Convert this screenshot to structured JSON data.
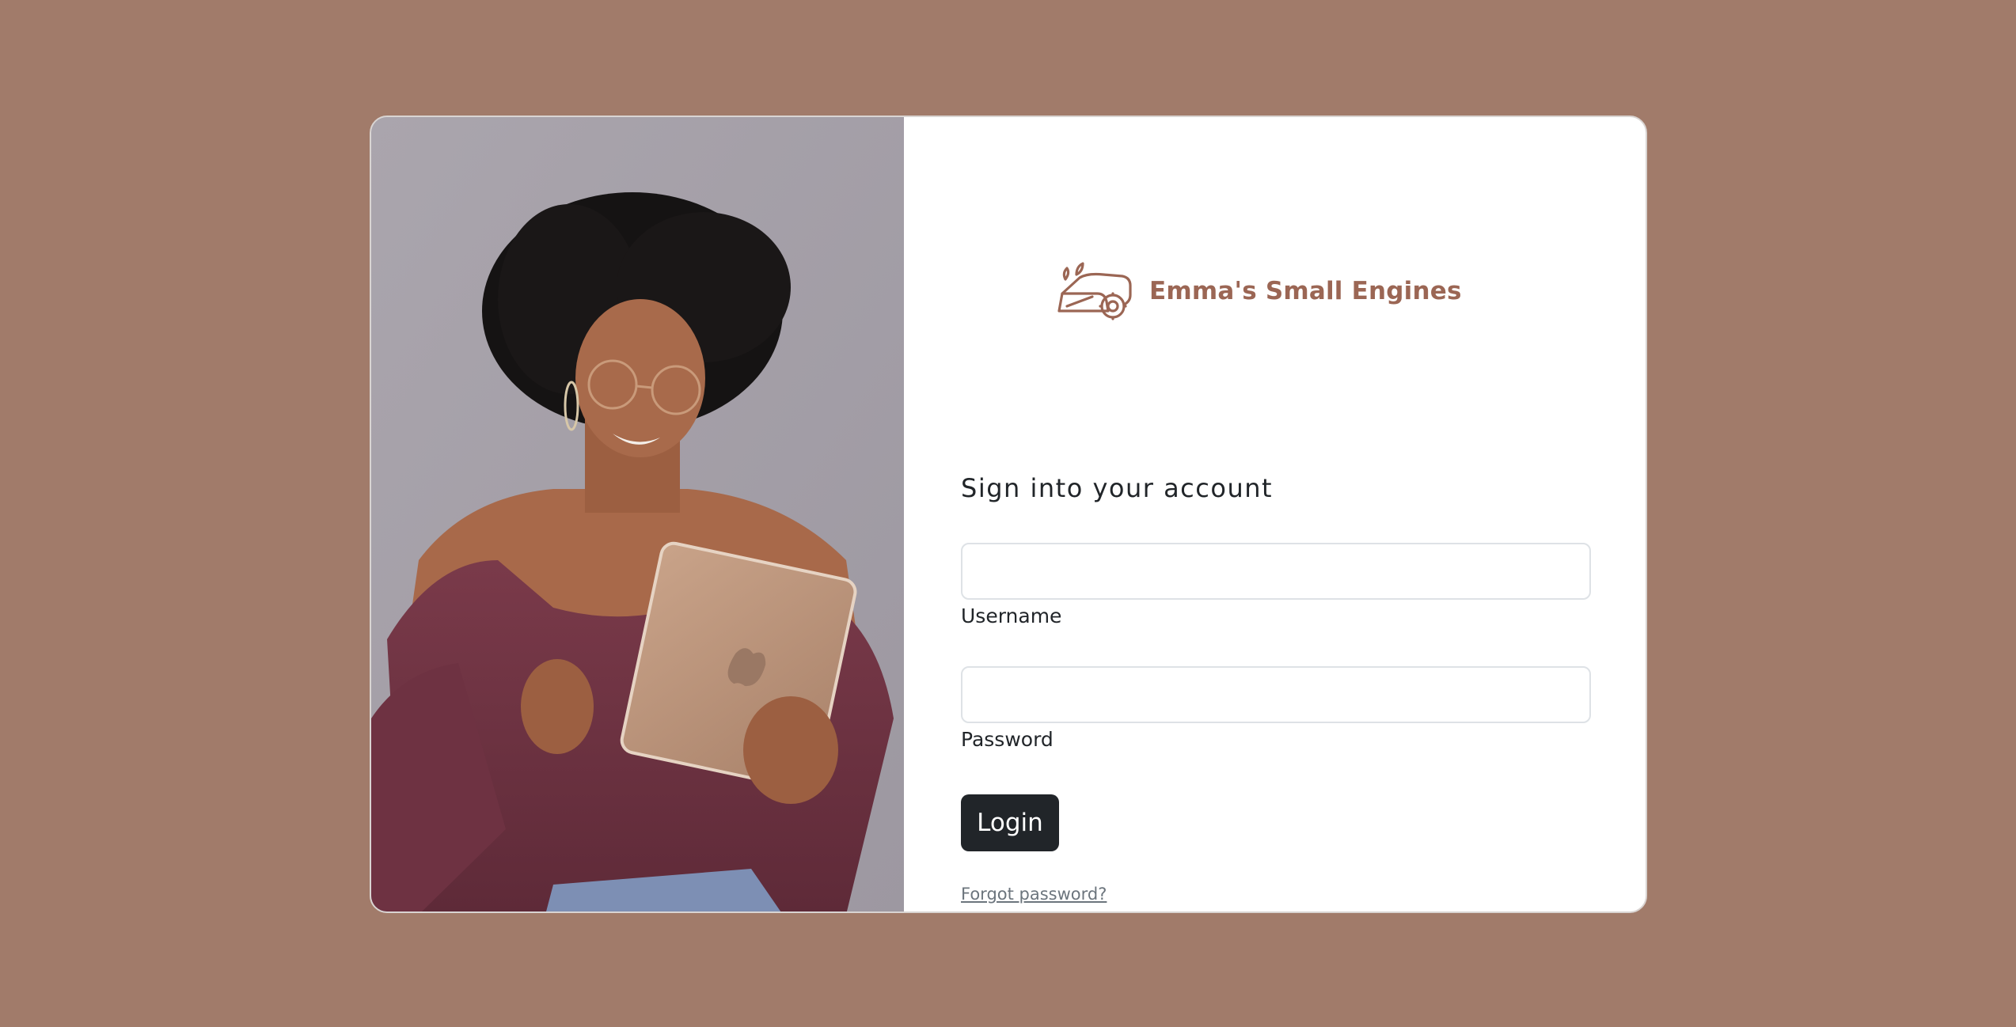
{
  "brand": {
    "name": "Emma's Small Engines",
    "logo_icon": "robot-lawn-mower-icon",
    "color": "#9b6654"
  },
  "photo": {
    "subject": "woman-with-tablet-photo"
  },
  "form": {
    "heading": "Sign into your account",
    "username": {
      "label": "Username",
      "value": "",
      "placeholder": ""
    },
    "password": {
      "label": "Password",
      "value": "",
      "placeholder": ""
    },
    "login_label": "Login",
    "forgot_label": "Forgot password?"
  },
  "colors": {
    "background": "#a17b6a",
    "card": "#ffffff",
    "button": "#212529",
    "link": "#6c757d"
  }
}
